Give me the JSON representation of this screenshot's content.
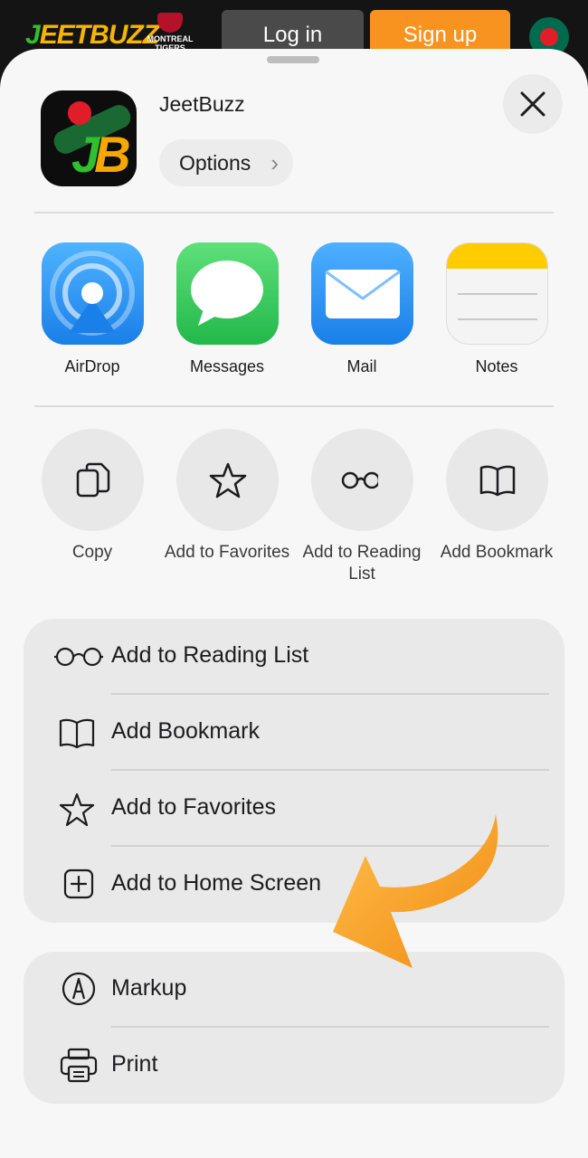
{
  "site": {
    "logo_j": "J",
    "logo_rest": "EETBUZZ",
    "partner_text": "MONTREAL TIGERS",
    "login_label": "Log in",
    "signup_label": "Sign up"
  },
  "sheet": {
    "app_name": "JeetBuzz",
    "options_label": "Options",
    "share_targets": [
      {
        "label": "AirDrop",
        "icon": "airdrop-icon"
      },
      {
        "label": "Messages",
        "icon": "messages-icon"
      },
      {
        "label": "Mail",
        "icon": "mail-icon"
      },
      {
        "label": "Notes",
        "icon": "notes-icon"
      }
    ],
    "quick_actions": [
      {
        "label": "Copy",
        "icon": "copy-icon"
      },
      {
        "label": "Add to Favorites",
        "icon": "star-icon"
      },
      {
        "label": "Add to Reading List",
        "icon": "glasses-icon"
      },
      {
        "label": "Add Bookmark",
        "icon": "book-icon"
      }
    ],
    "menu_group_1": [
      {
        "label": "Add to Reading List",
        "icon": "glasses-icon"
      },
      {
        "label": "Add Bookmark",
        "icon": "book-icon"
      },
      {
        "label": "Add to Favorites",
        "icon": "star-icon"
      },
      {
        "label": "Add to Home Screen",
        "icon": "plus-square-icon"
      }
    ],
    "menu_group_2": [
      {
        "label": "Markup",
        "icon": "markup-icon"
      },
      {
        "label": "Print",
        "icon": "printer-icon"
      }
    ]
  },
  "colors": {
    "signup": "#f7931e",
    "arrow": "#f7a21e",
    "airdrop": "#1e88f5",
    "messages": "#34c759",
    "mail": "#1a8cff",
    "notes_top": "#ffcc00"
  }
}
